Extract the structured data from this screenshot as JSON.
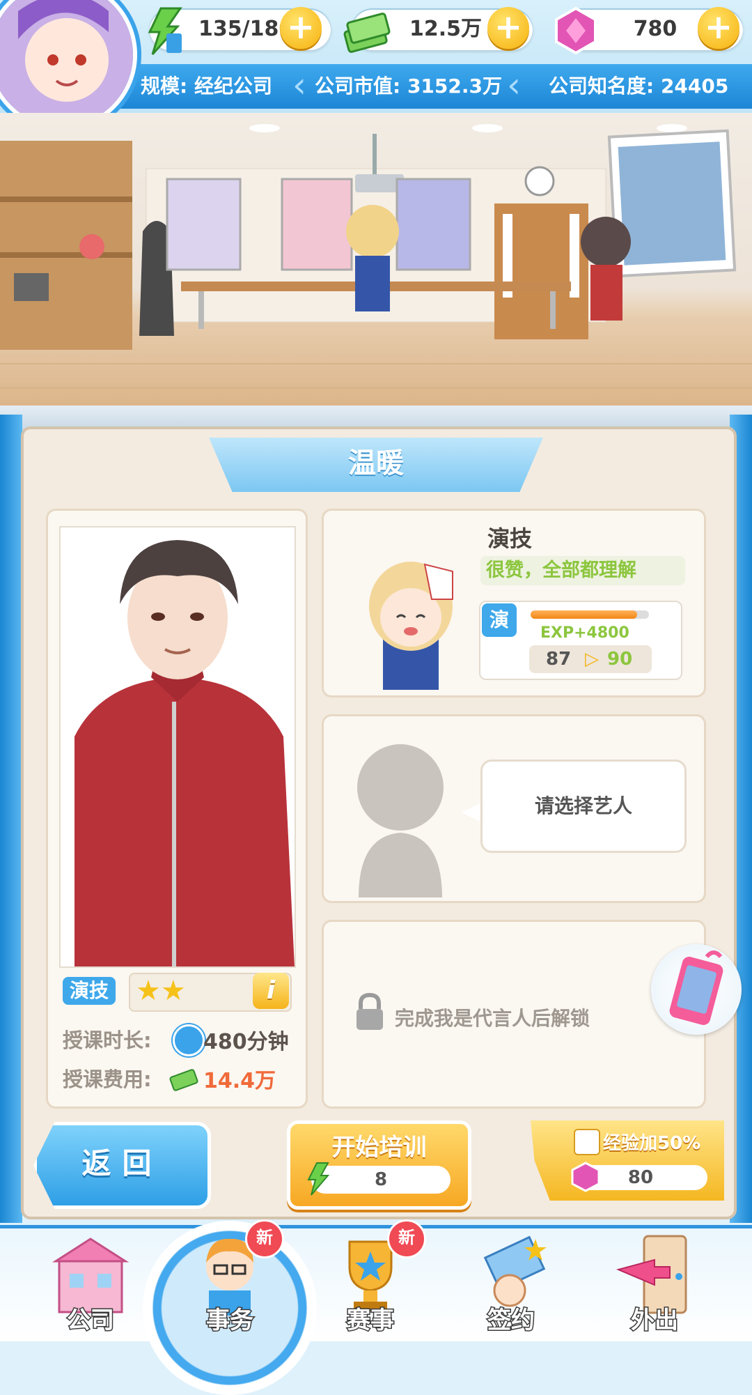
{
  "hud": {
    "stamina": "135/180",
    "cash": "12.5万",
    "gems": "780",
    "plus": "+",
    "scale": "规模: 经纪公司",
    "market_value": "公司市值: 3152.3万",
    "fame": "公司知名度: 24405"
  },
  "panel": {
    "title": "温暖",
    "teacher": {
      "skill_tag": "演技",
      "stars": 2,
      "duration_label": "授课时长:",
      "duration_value": "480分钟",
      "fee_label": "授课费用:",
      "fee_value": "14.4万",
      "info": "i"
    },
    "artist_slot": {
      "skill_name": "演技",
      "comment": "很赞，全部都理解",
      "tag": "演",
      "exp_text": "EXP+4800",
      "exp_progress": 0.9,
      "level_from": "87",
      "level_to": "90"
    },
    "empty_slot": {
      "prompt": "请选择艺人"
    },
    "locked_slot": {
      "text": "完成我是代言人后解锁"
    }
  },
  "actions": {
    "back": "返回",
    "start_label": "开始培训",
    "start_cost": "8",
    "bonus_label": "经验加50%",
    "bonus_cost": "80"
  },
  "nav": {
    "items": [
      {
        "label": "公司",
        "badge": ""
      },
      {
        "label": "事务",
        "badge": "新"
      },
      {
        "label": "赛事",
        "badge": "新"
      },
      {
        "label": "签约",
        "badge": ""
      },
      {
        "label": "外出",
        "badge": ""
      }
    ]
  },
  "colors": {
    "accent": "#2f93de",
    "gold": "#f7b10d",
    "green_text": "#8cc63e",
    "orange_fee": "#f06a3a"
  }
}
